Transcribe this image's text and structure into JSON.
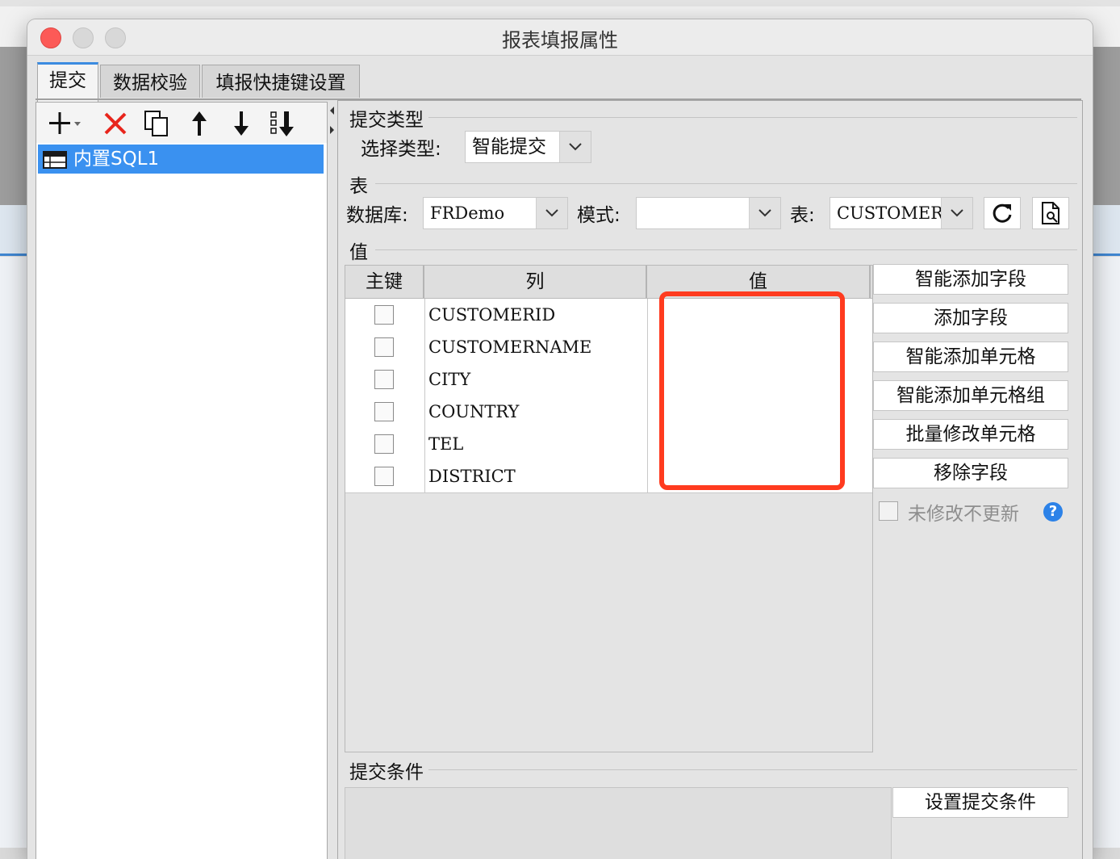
{
  "dialog": {
    "title": "报表填报属性"
  },
  "tabs": [
    {
      "label": "提交"
    },
    {
      "label": "数据校验"
    },
    {
      "label": "填报快捷键设置"
    }
  ],
  "tree": {
    "items": [
      {
        "label": "内置SQL1"
      }
    ]
  },
  "submit_type": {
    "section_title": "提交类型",
    "label": "选择类型:",
    "value": "智能提交"
  },
  "table_section": {
    "section_title": "表",
    "database_label": "数据库:",
    "database_value": "FRDemo",
    "mode_label": "模式:",
    "mode_value": "",
    "table_label": "表:",
    "table_value": "CUSTOMER"
  },
  "value_section": {
    "section_title": "值",
    "headers": [
      "主键",
      "列",
      "值"
    ],
    "rows": [
      {
        "column": "CUSTOMERID",
        "value": ""
      },
      {
        "column": "CUSTOMERNAME",
        "value": ""
      },
      {
        "column": "CITY",
        "value": ""
      },
      {
        "column": "COUNTRY",
        "value": ""
      },
      {
        "column": "TEL",
        "value": ""
      },
      {
        "column": "DISTRICT",
        "value": ""
      }
    ]
  },
  "side_buttons": [
    {
      "label": "智能添加字段"
    },
    {
      "label": "添加字段"
    },
    {
      "label": "智能添加单元格"
    },
    {
      "label": "智能添加单元格组"
    },
    {
      "label": "批量修改单元格"
    },
    {
      "label": "移除字段"
    }
  ],
  "no_update_checkbox": {
    "label": "未修改不更新",
    "checked": false
  },
  "condition_section": {
    "section_title": "提交条件",
    "button_label": "设置提交条件"
  },
  "colors": {
    "accent": "#3a91f0",
    "highlight": "#ff3b1f",
    "delete": "#e8251c"
  }
}
